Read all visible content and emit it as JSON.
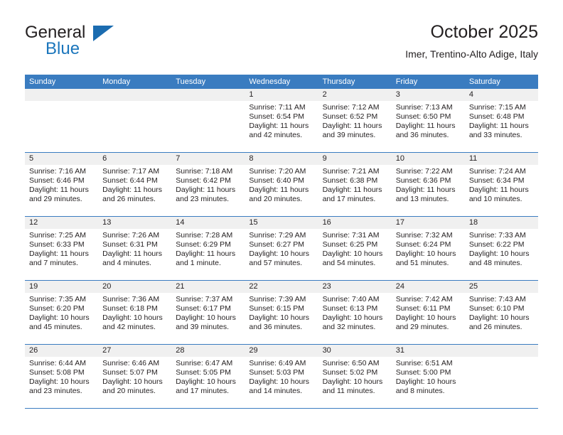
{
  "brand": {
    "name_primary": "General",
    "name_secondary": "Blue",
    "triangle_icon": "brand-triangle-icon",
    "accent_color": "#1b76bc"
  },
  "header": {
    "title": "October 2025",
    "subtitle": "Imer, Trentino-Alto Adige, Italy"
  },
  "theme": {
    "header_blue": "#3a7cc0",
    "band_gray": "#f0f0f0",
    "text": "#231f20"
  },
  "weekdays": [
    "Sunday",
    "Monday",
    "Tuesday",
    "Wednesday",
    "Thursday",
    "Friday",
    "Saturday"
  ],
  "weeks": [
    [
      {
        "day": "",
        "lines": []
      },
      {
        "day": "",
        "lines": []
      },
      {
        "day": "",
        "lines": []
      },
      {
        "day": "1",
        "lines": [
          "Sunrise: 7:11 AM",
          "Sunset: 6:54 PM",
          "Daylight: 11 hours",
          "and 42 minutes."
        ]
      },
      {
        "day": "2",
        "lines": [
          "Sunrise: 7:12 AM",
          "Sunset: 6:52 PM",
          "Daylight: 11 hours",
          "and 39 minutes."
        ]
      },
      {
        "day": "3",
        "lines": [
          "Sunrise: 7:13 AM",
          "Sunset: 6:50 PM",
          "Daylight: 11 hours",
          "and 36 minutes."
        ]
      },
      {
        "day": "4",
        "lines": [
          "Sunrise: 7:15 AM",
          "Sunset: 6:48 PM",
          "Daylight: 11 hours",
          "and 33 minutes."
        ]
      }
    ],
    [
      {
        "day": "5",
        "lines": [
          "Sunrise: 7:16 AM",
          "Sunset: 6:46 PM",
          "Daylight: 11 hours",
          "and 29 minutes."
        ]
      },
      {
        "day": "6",
        "lines": [
          "Sunrise: 7:17 AM",
          "Sunset: 6:44 PM",
          "Daylight: 11 hours",
          "and 26 minutes."
        ]
      },
      {
        "day": "7",
        "lines": [
          "Sunrise: 7:18 AM",
          "Sunset: 6:42 PM",
          "Daylight: 11 hours",
          "and 23 minutes."
        ]
      },
      {
        "day": "8",
        "lines": [
          "Sunrise: 7:20 AM",
          "Sunset: 6:40 PM",
          "Daylight: 11 hours",
          "and 20 minutes."
        ]
      },
      {
        "day": "9",
        "lines": [
          "Sunrise: 7:21 AM",
          "Sunset: 6:38 PM",
          "Daylight: 11 hours",
          "and 17 minutes."
        ]
      },
      {
        "day": "10",
        "lines": [
          "Sunrise: 7:22 AM",
          "Sunset: 6:36 PM",
          "Daylight: 11 hours",
          "and 13 minutes."
        ]
      },
      {
        "day": "11",
        "lines": [
          "Sunrise: 7:24 AM",
          "Sunset: 6:34 PM",
          "Daylight: 11 hours",
          "and 10 minutes."
        ]
      }
    ],
    [
      {
        "day": "12",
        "lines": [
          "Sunrise: 7:25 AM",
          "Sunset: 6:33 PM",
          "Daylight: 11 hours",
          "and 7 minutes."
        ]
      },
      {
        "day": "13",
        "lines": [
          "Sunrise: 7:26 AM",
          "Sunset: 6:31 PM",
          "Daylight: 11 hours",
          "and 4 minutes."
        ]
      },
      {
        "day": "14",
        "lines": [
          "Sunrise: 7:28 AM",
          "Sunset: 6:29 PM",
          "Daylight: 11 hours",
          "and 1 minute."
        ]
      },
      {
        "day": "15",
        "lines": [
          "Sunrise: 7:29 AM",
          "Sunset: 6:27 PM",
          "Daylight: 10 hours",
          "and 57 minutes."
        ]
      },
      {
        "day": "16",
        "lines": [
          "Sunrise: 7:31 AM",
          "Sunset: 6:25 PM",
          "Daylight: 10 hours",
          "and 54 minutes."
        ]
      },
      {
        "day": "17",
        "lines": [
          "Sunrise: 7:32 AM",
          "Sunset: 6:24 PM",
          "Daylight: 10 hours",
          "and 51 minutes."
        ]
      },
      {
        "day": "18",
        "lines": [
          "Sunrise: 7:33 AM",
          "Sunset: 6:22 PM",
          "Daylight: 10 hours",
          "and 48 minutes."
        ]
      }
    ],
    [
      {
        "day": "19",
        "lines": [
          "Sunrise: 7:35 AM",
          "Sunset: 6:20 PM",
          "Daylight: 10 hours",
          "and 45 minutes."
        ]
      },
      {
        "day": "20",
        "lines": [
          "Sunrise: 7:36 AM",
          "Sunset: 6:18 PM",
          "Daylight: 10 hours",
          "and 42 minutes."
        ]
      },
      {
        "day": "21",
        "lines": [
          "Sunrise: 7:37 AM",
          "Sunset: 6:17 PM",
          "Daylight: 10 hours",
          "and 39 minutes."
        ]
      },
      {
        "day": "22",
        "lines": [
          "Sunrise: 7:39 AM",
          "Sunset: 6:15 PM",
          "Daylight: 10 hours",
          "and 36 minutes."
        ]
      },
      {
        "day": "23",
        "lines": [
          "Sunrise: 7:40 AM",
          "Sunset: 6:13 PM",
          "Daylight: 10 hours",
          "and 32 minutes."
        ]
      },
      {
        "day": "24",
        "lines": [
          "Sunrise: 7:42 AM",
          "Sunset: 6:11 PM",
          "Daylight: 10 hours",
          "and 29 minutes."
        ]
      },
      {
        "day": "25",
        "lines": [
          "Sunrise: 7:43 AM",
          "Sunset: 6:10 PM",
          "Daylight: 10 hours",
          "and 26 minutes."
        ]
      }
    ],
    [
      {
        "day": "26",
        "lines": [
          "Sunrise: 6:44 AM",
          "Sunset: 5:08 PM",
          "Daylight: 10 hours",
          "and 23 minutes."
        ]
      },
      {
        "day": "27",
        "lines": [
          "Sunrise: 6:46 AM",
          "Sunset: 5:07 PM",
          "Daylight: 10 hours",
          "and 20 minutes."
        ]
      },
      {
        "day": "28",
        "lines": [
          "Sunrise: 6:47 AM",
          "Sunset: 5:05 PM",
          "Daylight: 10 hours",
          "and 17 minutes."
        ]
      },
      {
        "day": "29",
        "lines": [
          "Sunrise: 6:49 AM",
          "Sunset: 5:03 PM",
          "Daylight: 10 hours",
          "and 14 minutes."
        ]
      },
      {
        "day": "30",
        "lines": [
          "Sunrise: 6:50 AM",
          "Sunset: 5:02 PM",
          "Daylight: 10 hours",
          "and 11 minutes."
        ]
      },
      {
        "day": "31",
        "lines": [
          "Sunrise: 6:51 AM",
          "Sunset: 5:00 PM",
          "Daylight: 10 hours",
          "and 8 minutes."
        ]
      },
      {
        "day": "",
        "lines": []
      }
    ]
  ]
}
